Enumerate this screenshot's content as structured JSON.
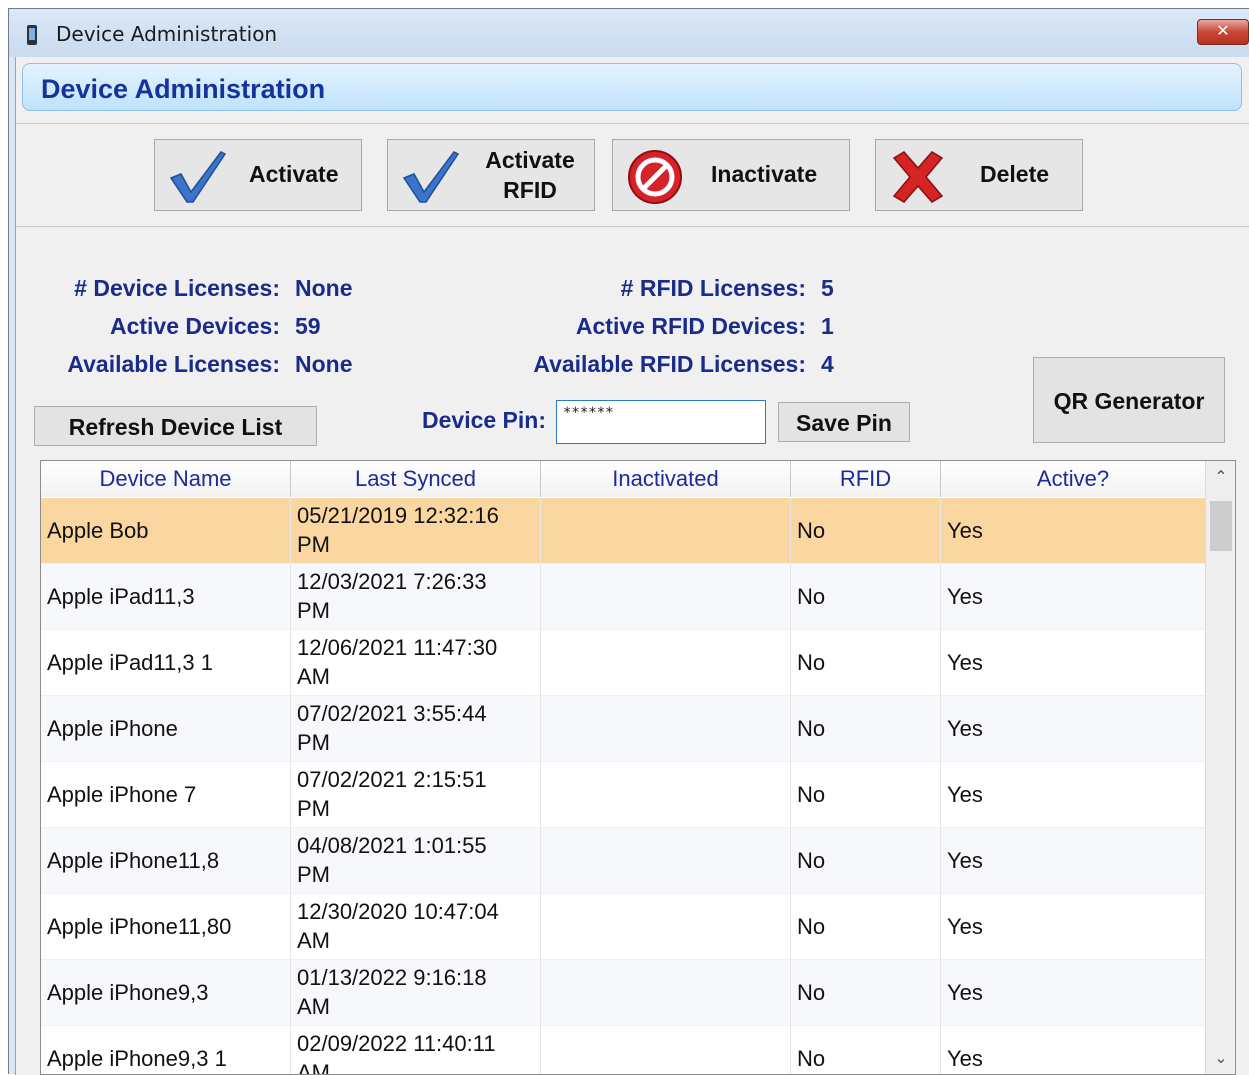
{
  "window": {
    "title": "Device Administration",
    "close_label": "✕"
  },
  "header": {
    "title": "Device Administration"
  },
  "toolbar": {
    "activate": "Activate",
    "activate_rfid_line1": "Activate",
    "activate_rfid_line2": "RFID",
    "inactivate": "Inactivate",
    "delete": "Delete"
  },
  "info": {
    "device_licenses_label": "# Device Licenses:",
    "device_licenses_value": "None",
    "active_devices_label": "Active Devices:",
    "active_devices_value": "59",
    "available_licenses_label": "Available Licenses:",
    "available_licenses_value": "None",
    "rfid_licenses_label": "# RFID Licenses:",
    "rfid_licenses_value": "5",
    "active_rfid_label": "Active RFID Devices:",
    "active_rfid_value": "1",
    "available_rfid_label": "Available RFID Licenses:",
    "available_rfid_value": "4"
  },
  "controls": {
    "refresh": "Refresh Device List",
    "pin_label": "Device Pin:",
    "pin_value": "******",
    "save_pin": "Save Pin",
    "qr": "QR Generator"
  },
  "grid": {
    "columns": [
      "Device Name",
      "Last Synced",
      "Inactivated",
      "RFID",
      "Active?"
    ],
    "rows": [
      {
        "name": "Apple Bob",
        "synced1": "05/21/2019 12:32:16",
        "synced2": "PM",
        "inactivated": "",
        "rfid": "No",
        "active": "Yes"
      },
      {
        "name": "Apple iPad11,3",
        "synced1": "12/03/2021 7:26:33",
        "synced2": "PM",
        "inactivated": "",
        "rfid": "No",
        "active": "Yes"
      },
      {
        "name": "Apple iPad11,3 1",
        "synced1": "12/06/2021 11:47:30",
        "synced2": "AM",
        "inactivated": "",
        "rfid": "No",
        "active": "Yes"
      },
      {
        "name": "Apple iPhone",
        "synced1": "07/02/2021 3:55:44",
        "synced2": "PM",
        "inactivated": "",
        "rfid": "No",
        "active": "Yes"
      },
      {
        "name": "Apple iPhone 7",
        "synced1": "07/02/2021 2:15:51",
        "synced2": "PM",
        "inactivated": "",
        "rfid": "No",
        "active": "Yes"
      },
      {
        "name": "Apple iPhone11,8",
        "synced1": "04/08/2021 1:01:55",
        "synced2": "PM",
        "inactivated": "",
        "rfid": "No",
        "active": "Yes"
      },
      {
        "name": "Apple iPhone11,80",
        "synced1": "12/30/2020 10:47:04",
        "synced2": "AM",
        "inactivated": "",
        "rfid": "No",
        "active": "Yes"
      },
      {
        "name": "Apple iPhone9,3",
        "synced1": "01/13/2022 9:16:18",
        "synced2": "AM",
        "inactivated": "",
        "rfid": "No",
        "active": "Yes"
      },
      {
        "name": "Apple iPhone9,3 1",
        "synced1": "02/09/2022 11:40:11",
        "synced2": "AM",
        "inactivated": "",
        "rfid": "No",
        "active": "Yes"
      }
    ],
    "selected_row": 0
  },
  "icons": {
    "activate": "checkmark-icon",
    "activate_rfid": "checkmark-icon",
    "inactivate": "no-entry-icon",
    "delete": "red-x-icon"
  }
}
